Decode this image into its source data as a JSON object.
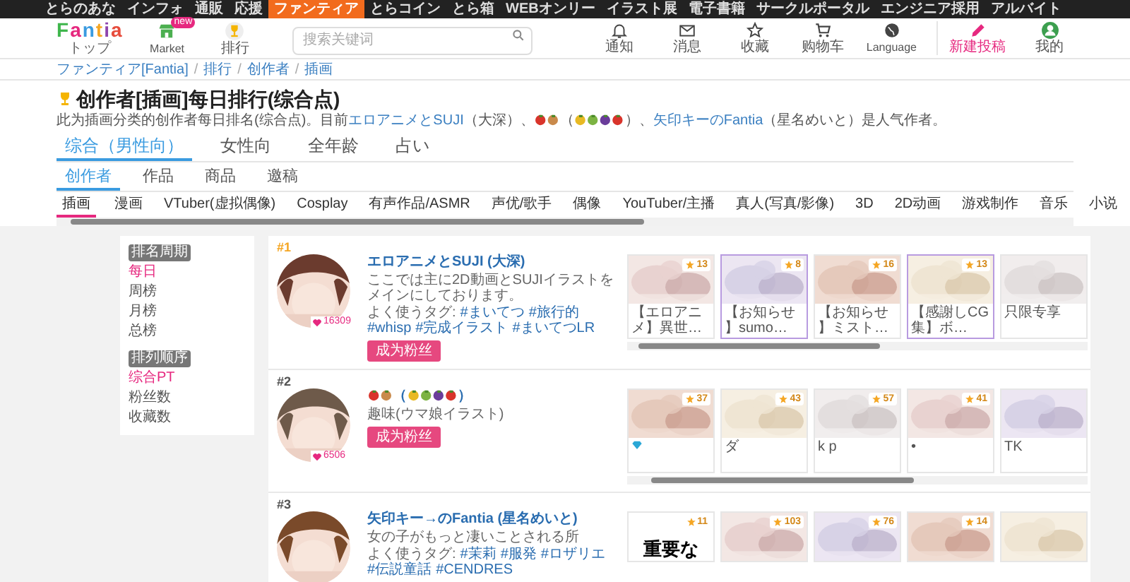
{
  "top_nav": [
    {
      "label": "とらのあな",
      "selected": false
    },
    {
      "label": "インフォ",
      "selected": false
    },
    {
      "label": "通販",
      "selected": false
    },
    {
      "label": "応援",
      "selected": false
    },
    {
      "label": "ファンティア",
      "selected": true
    },
    {
      "label": "とらコイン",
      "selected": false
    },
    {
      "label": "とら箱",
      "selected": false
    },
    {
      "label": "WEBオンリー",
      "selected": false
    },
    {
      "label": "イラスト展",
      "selected": false
    },
    {
      "label": "電子書籍",
      "selected": false
    },
    {
      "label": "サークルポータル",
      "selected": false
    },
    {
      "label": "エンジニア採用",
      "selected": false
    },
    {
      "label": "アルバイト",
      "selected": false
    }
  ],
  "header": {
    "logo": "Fantia",
    "logo_caption": "トップ",
    "shortcuts": [
      {
        "kind": "market",
        "label": "Market",
        "badge": "new"
      },
      {
        "kind": "ranking",
        "label": "排行"
      }
    ],
    "search": {
      "placeholder": "搜索关键词"
    },
    "actions": [
      {
        "kind": "bell",
        "label": "通知"
      },
      {
        "kind": "mail",
        "label": "消息"
      },
      {
        "kind": "star",
        "label": "收藏"
      },
      {
        "kind": "cart",
        "label": "购物车"
      },
      {
        "kind": "globe",
        "label": "Language"
      },
      {
        "kind": "post",
        "label": "新建投稿"
      },
      {
        "kind": "user",
        "label": "我的"
      }
    ]
  },
  "breadcrumb": [
    {
      "kind": "link",
      "text": "ファンティア[Fantia]"
    },
    {
      "kind": "sep",
      "text": "/"
    },
    {
      "kind": "link",
      "text": "排行"
    },
    {
      "kind": "sep",
      "text": "/"
    },
    {
      "kind": "link",
      "text": "创作者"
    },
    {
      "kind": "sep",
      "text": "/"
    },
    {
      "kind": "link",
      "text": "插画"
    }
  ],
  "title": "创作者[插画]每日排行(综合点)",
  "description": [
    {
      "kind": "text",
      "text": "此为插画分类的创作者每日排名(综合点)。目前"
    },
    {
      "kind": "link",
      "text": "エロアニメとSUJI"
    },
    {
      "kind": "text",
      "text": "（大深）、"
    },
    {
      "kind": "fruit_pair"
    },
    {
      "kind": "text",
      "text": "（"
    },
    {
      "kind": "fruit_quad"
    },
    {
      "kind": "text",
      "text": "）、"
    },
    {
      "kind": "link",
      "text": "矢印キーのFantia"
    },
    {
      "kind": "text",
      "text": "（星名めいと）是人气作者。"
    }
  ],
  "audience_tabs": [
    {
      "label": "综合（男性向）",
      "selected": true
    },
    {
      "label": "女性向",
      "selected": false
    },
    {
      "label": "全年龄",
      "selected": false
    },
    {
      "label": "占い",
      "selected": false
    }
  ],
  "type_tabs": [
    {
      "label": "创作者",
      "selected": true
    },
    {
      "label": "作品",
      "selected": false
    },
    {
      "label": "商品",
      "selected": false
    },
    {
      "label": "邀稿",
      "selected": false
    }
  ],
  "categories": [
    {
      "label": "插画",
      "selected": true
    },
    {
      "label": "漫画",
      "selected": false
    },
    {
      "label": "VTuber(虚拟偶像)",
      "selected": false
    },
    {
      "label": "Cosplay",
      "selected": false
    },
    {
      "label": "有声作品/ASMR",
      "selected": false
    },
    {
      "label": "声优/歌手",
      "selected": false
    },
    {
      "label": "偶像",
      "selected": false
    },
    {
      "label": "YouTuber/主播",
      "selected": false
    },
    {
      "label": "真人(写真/影像)",
      "selected": false
    },
    {
      "label": "3D",
      "selected": false
    },
    {
      "label": "2D动画",
      "selected": false
    },
    {
      "label": "游戏制作",
      "selected": false
    },
    {
      "label": "音乐",
      "selected": false
    },
    {
      "label": "小说",
      "selected": false
    }
  ],
  "sidebar": [
    {
      "heading": "排名周期",
      "items": [
        {
          "label": "每日",
          "selected": true
        },
        {
          "label": "周榜",
          "selected": false
        },
        {
          "label": "月榜",
          "selected": false
        },
        {
          "label": "总榜",
          "selected": false
        }
      ]
    },
    {
      "heading": "排列顺序",
      "items": [
        {
          "label": "综合PT",
          "selected": true
        },
        {
          "label": "粉丝数",
          "selected": false
        },
        {
          "label": "收藏数",
          "selected": false
        }
      ]
    }
  ],
  "creators": [
    {
      "rank": "#1",
      "name": [
        {
          "kind": "text",
          "text": "エロアニメとSUJI (大深)"
        }
      ],
      "likes": "16309",
      "bio": "ここでは主に2D動画とSUJIイラストをメインにしております。",
      "tags_label": "よく使うタグ:",
      "tags": [
        "#まいてつ",
        "#旅行的",
        "#whisp",
        "#完成イラスト",
        "#まいてつLR"
      ],
      "follow": "成为粉丝",
      "posts": [
        {
          "kind": "picture",
          "favorites": "13",
          "caption": "【エロアニメ】異世…",
          "featured": false
        },
        {
          "kind": "picture",
          "favorites": "8",
          "caption": "【お知らせ】sumo…",
          "featured": true
        },
        {
          "kind": "picture",
          "favorites": "16",
          "caption": "【お知らせ】ミスト…",
          "featured": false
        },
        {
          "kind": "picture",
          "favorites": "13",
          "caption": "【感謝しCG集】ボ…",
          "featured": true
        },
        {
          "kind": "picture",
          "caption": "只限专享",
          "featured": false
        }
      ]
    },
    {
      "rank": "#2",
      "name": [
        {
          "kind": "fruit_pair"
        },
        {
          "kind": "text",
          "text": "（"
        },
        {
          "kind": "fruit_quad"
        },
        {
          "kind": "text",
          "text": "）"
        }
      ],
      "likes": "6506",
      "bio": "趣味(ウマ娘イラスト)",
      "follow": "成为粉丝",
      "posts": [
        {
          "kind": "picture",
          "favorites": "37",
          "caption_icon": true
        },
        {
          "kind": "picture",
          "favorites": "43",
          "caption": "ダ"
        },
        {
          "kind": "picture",
          "favorites": "57",
          "caption": "k p"
        },
        {
          "kind": "picture",
          "favorites": "41",
          "caption": "•"
        },
        {
          "kind": "picture",
          "caption": "TK"
        }
      ]
    },
    {
      "rank": "#3",
      "name": [
        {
          "kind": "text",
          "text": "矢印キー→のFantia (星名めいと)"
        }
      ],
      "bio": "女の子がもっと凄いことされる所",
      "tags_label": "よく使うタグ:",
      "tags": [
        "#茉莉",
        "#服発",
        "#ロザリエ",
        "#伝説童話",
        "#CENDRES"
      ],
      "posts": [
        {
          "kind": "notice",
          "favorites": "11",
          "headline": "重要な"
        },
        {
          "kind": "picture",
          "favorites": "103"
        },
        {
          "kind": "picture",
          "favorites": "76"
        },
        {
          "kind": "picture",
          "favorites": "14"
        },
        {
          "kind": "picture"
        }
      ]
    }
  ]
}
